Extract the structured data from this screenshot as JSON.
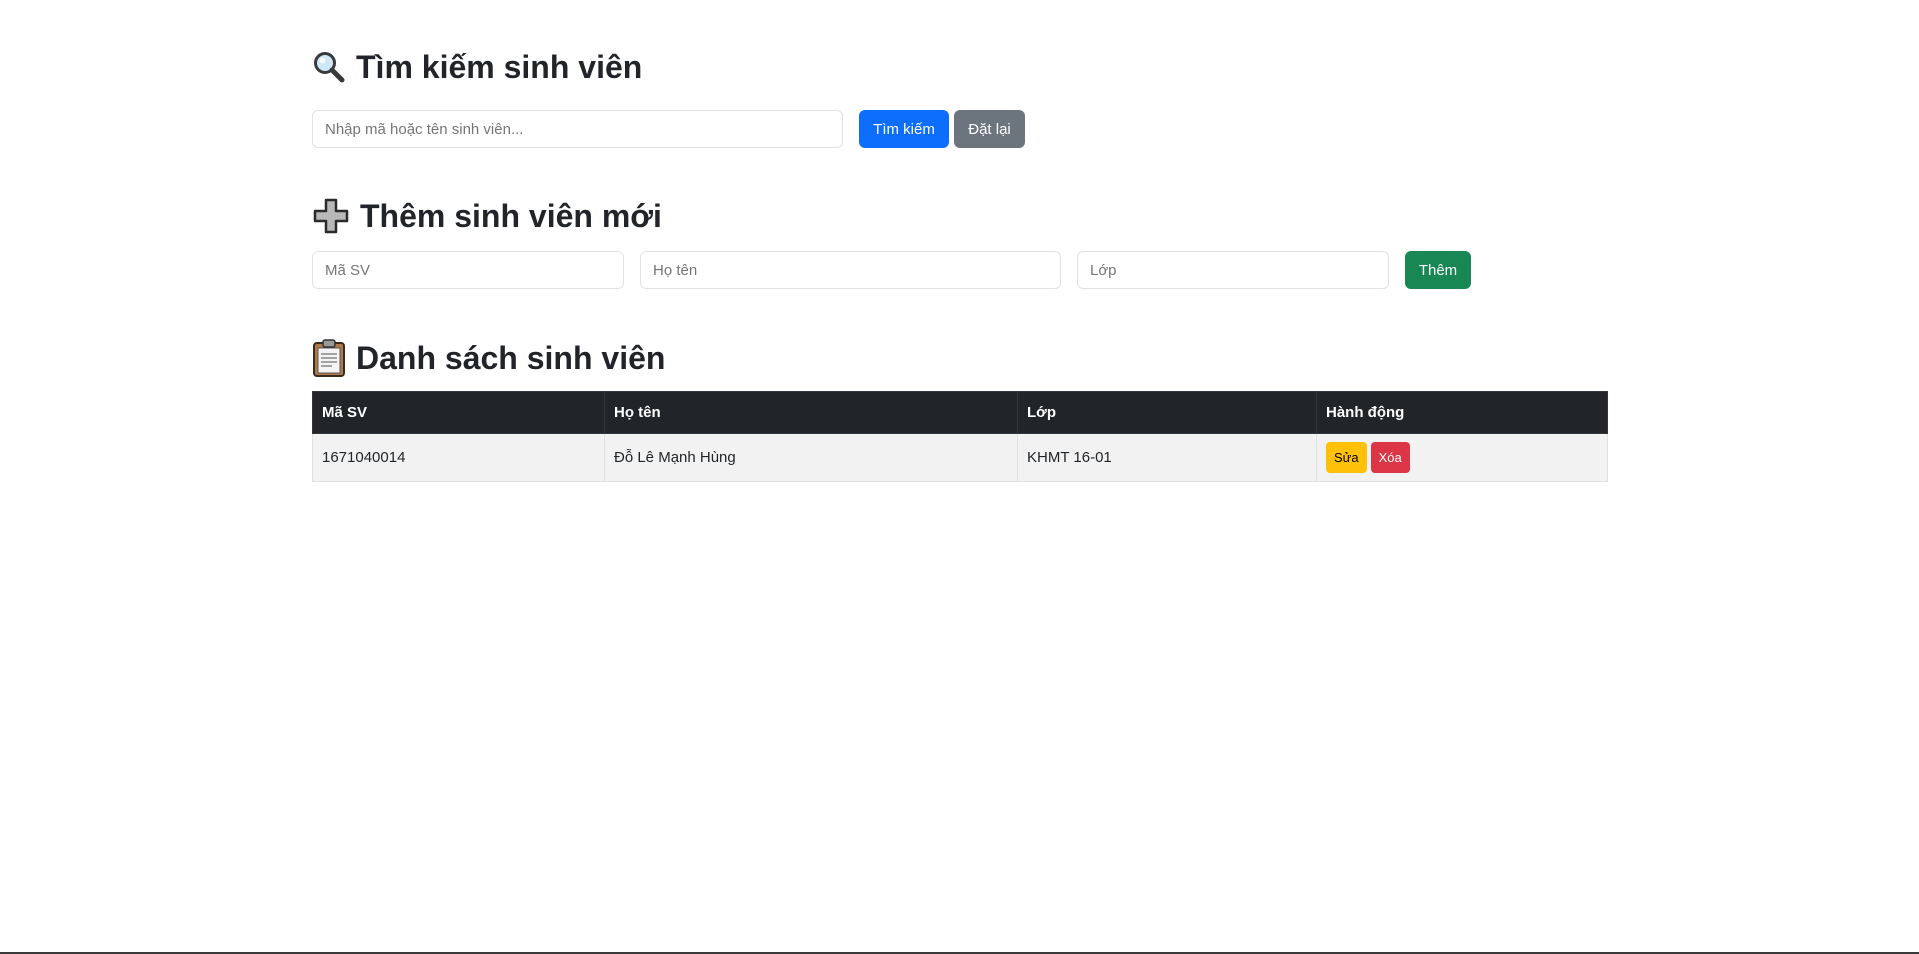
{
  "search": {
    "title": "Tìm kiếm sinh viên",
    "icon": "magnifier-icon",
    "placeholder": "Nhập mã hoặc tên sinh viên...",
    "value": "",
    "search_label": "Tìm kiếm",
    "reset_label": "Đặt lại"
  },
  "add": {
    "title": "Thêm sinh viên mới",
    "icon": "plus-icon",
    "fields": {
      "ma_placeholder": "Mã SV",
      "ten_placeholder": "Họ tên",
      "lop_placeholder": "Lớp"
    },
    "submit_label": "Thêm"
  },
  "list": {
    "title": "Danh sách sinh viên",
    "icon": "clipboard-icon",
    "columns": [
      "Mã SV",
      "Họ tên",
      "Lớp",
      "Hành động"
    ],
    "rows": [
      {
        "ma": "1671040014",
        "ten": "Đỗ Lê Mạnh Hùng",
        "lop": "KHMT 16-01",
        "edit_label": "Sửa",
        "delete_label": "Xóa"
      }
    ]
  },
  "colors": {
    "primary": "#0d6efd",
    "secondary": "#6c757d",
    "success": "#198754",
    "warning": "#ffc107",
    "danger": "#dc3545",
    "table_header": "#212529"
  }
}
